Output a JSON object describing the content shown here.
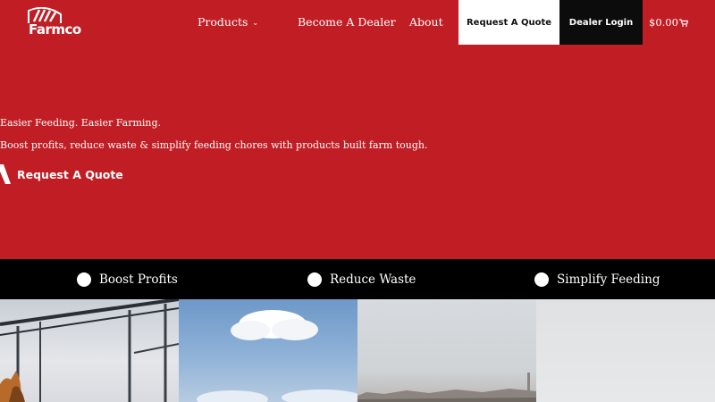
{
  "brand": {
    "name": "Farmco"
  },
  "nav": {
    "products": "Products",
    "become_dealer": "Become A Dealer",
    "about": "About",
    "quote_button": "Request A Quote",
    "login_button": "Dealer Login",
    "cart_total": "$0.00"
  },
  "hero": {
    "tagline": "Easier Feeding. Easier Farming.",
    "subtitle": "Boost profits, reduce waste & simplify feeding chores with products built farm tough.",
    "cta": "Request A Quote"
  },
  "benefits": [
    {
      "label": "Boost Profits"
    },
    {
      "label": "Reduce Waste"
    },
    {
      "label": "Simplify Feeding"
    }
  ],
  "colors": {
    "brand_red": "#c01d24",
    "black": "#000000",
    "white": "#ffffff"
  },
  "icons": [
    "chevron-down-icon",
    "cart-icon",
    "arrow-icon",
    "bullet-dot-icon"
  ]
}
